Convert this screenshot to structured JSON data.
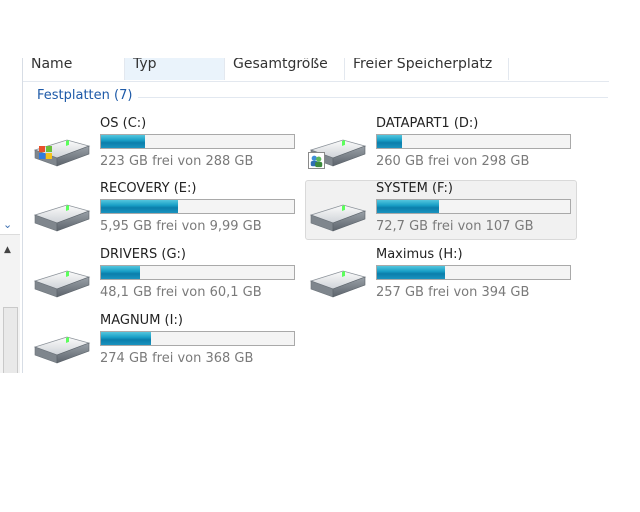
{
  "columns": [
    "Name",
    "Typ",
    "Gesamtgröße",
    "Freier Speicherplatz"
  ],
  "group": {
    "title": "Festplatten (7)"
  },
  "drives": [
    {
      "label": "OS (C:)",
      "free_text": "223 GB frei von 288 GB",
      "used_fraction": 0.23,
      "icon": "system-drive-icon"
    },
    {
      "label": "DATAPART1 (D:)",
      "free_text": "260 GB frei von 298 GB",
      "used_fraction": 0.13,
      "icon": "shared-drive-icon"
    },
    {
      "label": "RECOVERY (E:)",
      "free_text": "5,95 GB frei von 9,99 GB",
      "used_fraction": 0.4,
      "icon": "hard-drive-icon"
    },
    {
      "label": "SYSTEM (F:)",
      "free_text": "72,7 GB frei von 107 GB",
      "used_fraction": 0.32,
      "icon": "hard-drive-icon",
      "selected": true
    },
    {
      "label": "DRIVERS (G:)",
      "free_text": "48,1 GB frei von 60,1 GB",
      "used_fraction": 0.2,
      "icon": "hard-drive-icon"
    },
    {
      "label": "Maximus (H:)",
      "free_text": "257 GB frei von 394 GB",
      "used_fraction": 0.35,
      "icon": "hard-drive-icon"
    },
    {
      "label": "MAGNUM (I:)",
      "free_text": "274 GB frei von 368 GB",
      "used_fraction": 0.26,
      "icon": "hard-drive-icon"
    }
  ],
  "colors": {
    "bar_fill": "#1aa0c7",
    "group_title": "#1e5aa8",
    "free_text": "#7a7a7a"
  }
}
